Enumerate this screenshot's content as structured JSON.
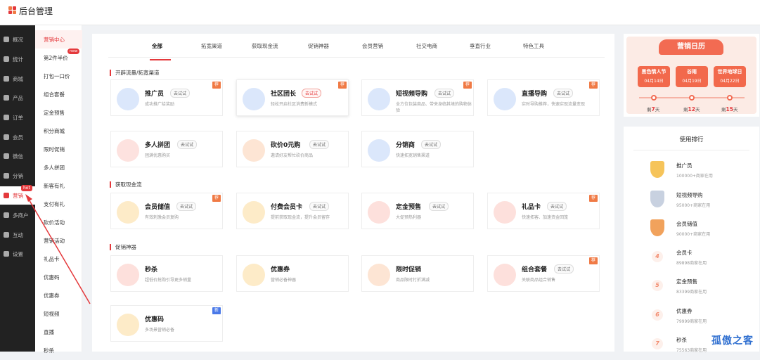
{
  "app": {
    "title": "后台管理"
  },
  "sidebar": {
    "items": [
      {
        "label": "概况"
      },
      {
        "label": "统计"
      },
      {
        "label": "商城"
      },
      {
        "label": "产品"
      },
      {
        "label": "订单"
      },
      {
        "label": "会员"
      },
      {
        "label": "微信"
      },
      {
        "label": "分销"
      },
      {
        "label": "营销",
        "badge": "hot"
      },
      {
        "label": "多商户"
      },
      {
        "label": "互动"
      },
      {
        "label": "设置"
      }
    ]
  },
  "submenu": {
    "items": [
      {
        "label": "营销中心"
      },
      {
        "label": "第2件半价",
        "badge": "new"
      },
      {
        "label": "打包一口价"
      },
      {
        "label": "组合套餐"
      },
      {
        "label": "定金预售"
      },
      {
        "label": "积分商城"
      },
      {
        "label": "限时促销"
      },
      {
        "label": "多人拼团"
      },
      {
        "label": "新客有礼"
      },
      {
        "label": "支付有礼"
      },
      {
        "label": "砍价活动"
      },
      {
        "label": "营销活动"
      },
      {
        "label": "礼品卡"
      },
      {
        "label": "优惠码"
      },
      {
        "label": "优惠券"
      },
      {
        "label": "短视频"
      },
      {
        "label": "直播"
      },
      {
        "label": "秒杀"
      }
    ]
  },
  "tabs": [
    {
      "label": "全部"
    },
    {
      "label": "拓宽渠道"
    },
    {
      "label": "获取现金流"
    },
    {
      "label": "促销神器"
    },
    {
      "label": "会员营销"
    },
    {
      "label": "社交电商"
    },
    {
      "label": "垂直行业"
    },
    {
      "label": "特色工具"
    }
  ],
  "sections": [
    {
      "title": "开辟流量/拓宽渠道",
      "cards": [
        {
          "name": "推广员",
          "try": "去试试",
          "desc": "成功推广给奖励",
          "tag": "荐"
        },
        {
          "name": "社区团长",
          "try": "去试试",
          "desc": "轻松开启社区消费新模式",
          "tag": "荐"
        },
        {
          "name": "短视频导购",
          "try": "去试试",
          "desc": "全方位包装商品、带来身临其境的购物体验",
          "tag": "荐"
        },
        {
          "name": "直播导购",
          "try": "去试试",
          "desc": "实时导购推荐，快速实现流量变现",
          "tag": "荐"
        },
        {
          "name": "多人拼团",
          "try": "去试试",
          "desc": "团满优惠购买"
        },
        {
          "name": "砍价0元购",
          "try": "去试试",
          "desc": "邀请好友帮忙砍价商品"
        },
        {
          "name": "分销商",
          "try": "去试试",
          "desc": "快速拓宽销售渠道"
        }
      ]
    },
    {
      "title": "获取现金流",
      "cards": [
        {
          "name": "会员储值",
          "try": "去试试",
          "desc": "有效刺激会员复购",
          "tag": "荐"
        },
        {
          "name": "付费会员卡",
          "try": "去试试",
          "desc": "提前获取现金流，提升会员留存"
        },
        {
          "name": "定金预售",
          "try": "去试试",
          "desc": "大促预热利器"
        },
        {
          "name": "礼品卡",
          "try": "去试试",
          "desc": "快速拓客、加速资金回笼",
          "tag": "荐"
        }
      ]
    },
    {
      "title": "促销神器",
      "cards": [
        {
          "name": "秒杀",
          "desc": "超低价抢购引导更多销量"
        },
        {
          "name": "优惠券",
          "desc": "营销必备神器"
        },
        {
          "name": "限时促销",
          "desc": "商品限时打折满减"
        },
        {
          "name": "组合套餐",
          "try": "去试试",
          "desc": "关联商品组合销售",
          "tag": "荐"
        },
        {
          "name": "优惠码",
          "desc": "多场景营销必备",
          "tag": "新"
        }
      ]
    }
  ],
  "calendar": {
    "title": "营销日历",
    "events": [
      {
        "name": "黑色情人节",
        "date": "04月14日",
        "countdown_prefix": "剩",
        "countdown_value": "7",
        "countdown_unit": "天"
      },
      {
        "name": "谷雨",
        "date": "04月19日",
        "countdown_prefix": "剩",
        "countdown_value": "12",
        "countdown_unit": "天"
      },
      {
        "name": "世界地球日",
        "date": "04月22日",
        "countdown_prefix": "剩",
        "countdown_value": "15",
        "countdown_unit": "天"
      }
    ]
  },
  "ranking": {
    "title": "使用排行",
    "items": [
      {
        "rank": "1",
        "name": "推广员",
        "sub": "100000+商家在用"
      },
      {
        "rank": "2",
        "name": "短视频导购",
        "sub": "95000+商家在用"
      },
      {
        "rank": "3",
        "name": "会员储值",
        "sub": "90000+商家在用"
      },
      {
        "rank": "4",
        "name": "会员卡",
        "sub": "89898商家在用"
      },
      {
        "rank": "5",
        "name": "定金预售",
        "sub": "83399商家在用"
      },
      {
        "rank": "6",
        "name": "优惠券",
        "sub": "79999商家在用"
      },
      {
        "rank": "7",
        "name": "秒杀",
        "sub": "75563商家在用"
      }
    ]
  },
  "watermark": "孤傲之客",
  "colors": {
    "accent": "#e4393c",
    "calendar": "#f26b52",
    "tag_recommend": "#f07a45",
    "tag_new": "#4a79e8"
  }
}
